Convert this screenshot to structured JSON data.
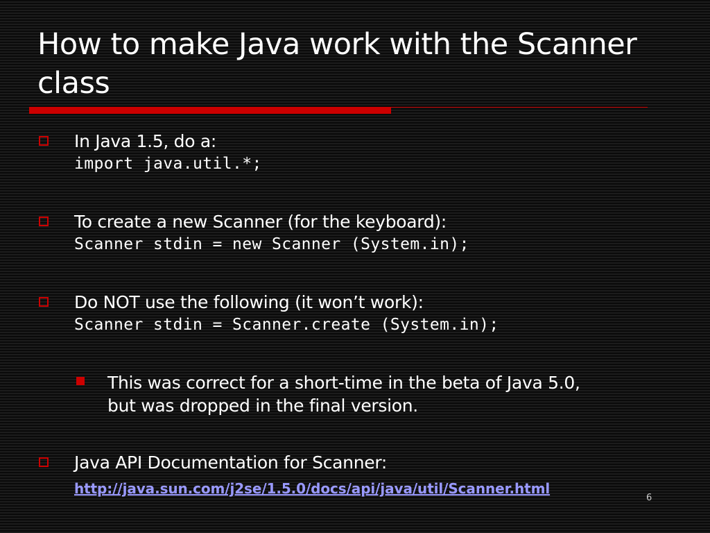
{
  "slide": {
    "title": "How to make Java work with the Scanner class",
    "bullets": [
      {
        "text": "In Java 1.5, do a:",
        "code": "import java.util.*;"
      },
      {
        "text": "To create a new Scanner (for the keyboard):",
        "code": "Scanner stdin = new Scanner (System.in);"
      },
      {
        "text": "Do NOT use the following (it won’t work):",
        "code": "Scanner stdin = Scanner.create (System.in);"
      }
    ],
    "sub_bullet": {
      "line1": "This was correct for a short-time in the beta of Java 5.0,",
      "line2": "but was dropped in the final version."
    },
    "last_bullet": {
      "text": "Java API Documentation for Scanner:",
      "link": "http://java.sun.com/j2se/1.5.0/docs/api/java/util/Scanner.html"
    },
    "slide_number": "6"
  },
  "colors": {
    "background": "#000000",
    "accent": "#cc0000",
    "text": "#ffffff",
    "link": "#9999ff"
  }
}
